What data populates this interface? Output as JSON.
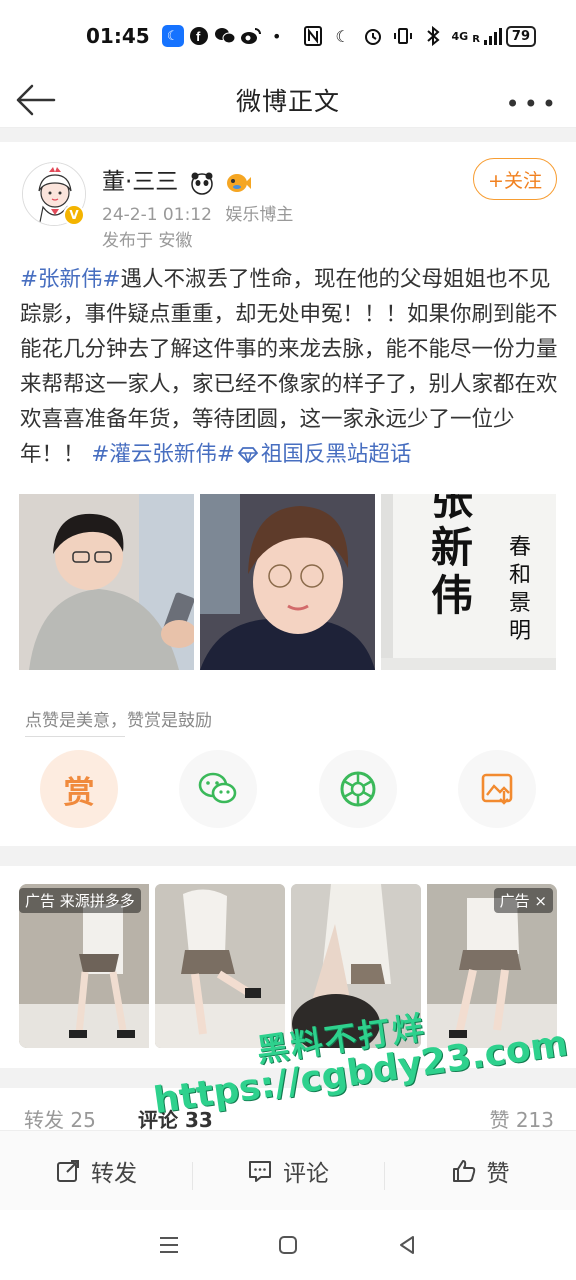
{
  "status_bar": {
    "time": "01:45",
    "network": "4G",
    "signal_label": "R",
    "battery": "79",
    "icons": [
      "app-badge-icon",
      "facebook-icon",
      "wechat-icon",
      "weibo-icon",
      "nfc-icon",
      "moon-icon",
      "alarm-icon",
      "vibrate-icon",
      "bluetooth-icon",
      "signal-icon",
      "battery-icon"
    ]
  },
  "titlebar": {
    "title": "微博正文"
  },
  "post": {
    "author": "董·三三",
    "timestamp": "24-2-1 01:12",
    "author_tag": "娱乐博主",
    "location": "发布于 安徽",
    "follow_label": "+关注",
    "text_parts": [
      {
        "type": "tag",
        "text": "#张新伟#"
      },
      {
        "type": "text",
        "text": "遇人不淑丢了性命，现在他的父母姐姐也不见踪影，事件疑点重重，却无处申冤！！！如果你刷到能不能花几分钟去了解这件事的来龙去脉，能不能尽一份力量来帮帮这一家人，家已经不像家的样子了，别人家都在欢欢喜喜准备年货，等待团圆，这一家永远少了一位少年！！ "
      },
      {
        "type": "tag",
        "text": "#灌云张新伟#"
      },
      {
        "type": "tag",
        "text": "祖国反黑站超话"
      }
    ],
    "photo3_text": {
      "big": "张新伟",
      "side": "春和景明"
    }
  },
  "reward": {
    "hint": "点赞是美意，赞赏是鼓励",
    "reward_label": "赏"
  },
  "ads": {
    "left_label": "广告 来源拼多多",
    "right_label": "广告 ×"
  },
  "stats": {
    "repost": "转发 25",
    "comment": "评论 33",
    "like": "赞 213"
  },
  "watermark": {
    "line1": "黑料不打烊",
    "line2": "https://cgbdy23.com"
  },
  "actions": {
    "repost": "转发",
    "comment": "评论",
    "like": "赞"
  },
  "colors": {
    "accent": "#f18120",
    "link": "#476ec0",
    "watermark": "#2ed18d"
  }
}
